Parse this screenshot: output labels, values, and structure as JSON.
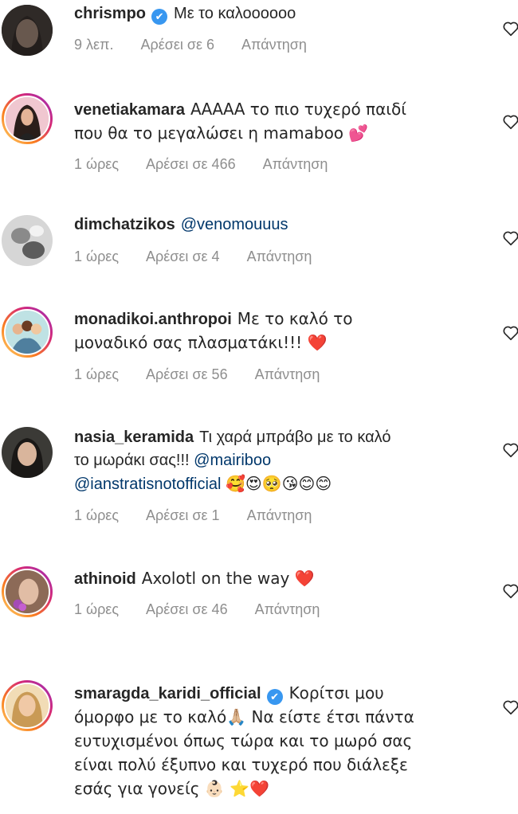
{
  "comments": [
    {
      "username": "chrismpo",
      "verified": true,
      "text": "Με το καλοοοοοο",
      "time": "9 λεπ.",
      "likes": "Αρέσει σε 6",
      "reply": "Απάντηση"
    },
    {
      "username": "venetiakamara",
      "verified": false,
      "text": "ΑΑΑΑΑ το πιο τυχερό παιδί που θα το μεγαλώσει η mamaboo 💕",
      "time": "1 ώρες",
      "likes": "Αρέσει σε 466",
      "reply": "Απάντηση"
    },
    {
      "username": "dimchatzikos",
      "verified": false,
      "text": "@venomouuus",
      "time": "1 ώρες",
      "likes": "Αρέσει σε 4",
      "reply": "Απάντηση"
    },
    {
      "username": "monadikoi.anthropoi",
      "verified": false,
      "text": "Με το καλό το μοναδικό σας πλασματάκι!!! ❤️",
      "time": "1 ώρες",
      "likes": "Αρέσει σε 56",
      "reply": "Απάντηση"
    },
    {
      "username": "nasia_keramida",
      "verified": false,
      "text": "Τι χαρά μπράβο με το καλό το μωράκι σας!!!",
      "mention1": "@mairiboo",
      "mention2": "@ianstratisnotofficial",
      "emojis": "🥰😍🥺😘😊😊",
      "time": "1 ώρες",
      "likes": "Αρέσει σε 1",
      "reply": "Απάντηση"
    },
    {
      "username": "athinoid",
      "verified": false,
      "text": "Axolotl on the way ❤️",
      "time": "1 ώρες",
      "likes": "Αρέσει σε 46",
      "reply": "Απάντηση"
    },
    {
      "username": "smaragda_karidi_official",
      "verified": true,
      "text": "Κορίτσι μου όμορφο με το καλό🙏🏼 Να είστε έτσι πάντα ευτυχισμένοι όπως τώρα και το μωρό σας είναι πολύ έξυπνο και τυχερό που διάλεξε εσάς για γονείς 👶🏻 ⭐❤️"
    }
  ],
  "icons": {
    "verified": "✔",
    "like": "heart-outline-icon"
  }
}
